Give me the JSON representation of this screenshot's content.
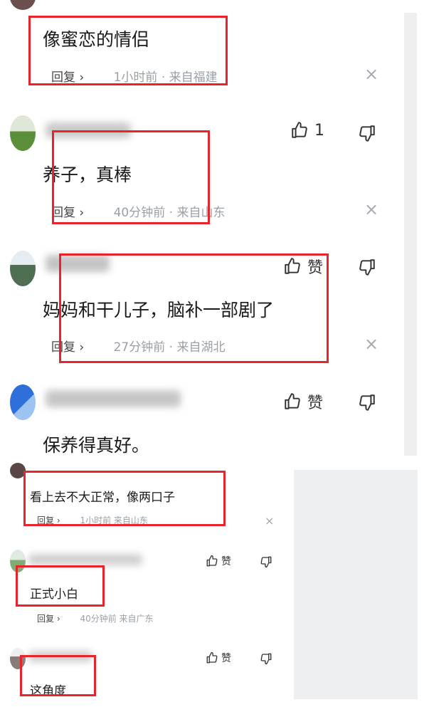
{
  "comments": [
    {
      "text": "像蜜恋的情侣",
      "reply": "回复 ›",
      "meta": "1小时前 · 来自福建",
      "close": "×"
    },
    {
      "text": "养子，真棒",
      "reply": "回复 ›",
      "meta": "40分钟前 · 来自山东",
      "close": "×",
      "like": "1"
    },
    {
      "text": "妈妈和干儿子，脑补一部剧了",
      "reply": "回复 ›",
      "meta": "27分钟前 · 来自湖北",
      "close": "×",
      "like": "赞"
    },
    {
      "text": "保养得真好。",
      "like": "赞"
    },
    {
      "text": "看上去不大正常，像两口子",
      "reply": "回复 ›",
      "meta": "1小时前  来自山东",
      "close": "×"
    },
    {
      "text": "正式小白",
      "reply": "回复 ›",
      "meta": "40分钟前   来自广东",
      "like": "赞"
    },
    {
      "text": "这角度",
      "like": "赞"
    }
  ],
  "colors": {
    "highlight_box": "#e8242b",
    "meta_gray": "#9aa0a6"
  }
}
